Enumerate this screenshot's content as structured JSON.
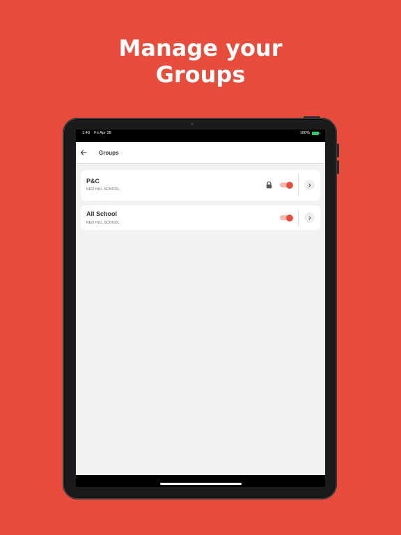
{
  "headline": {
    "line1": "Manage your",
    "line2": "Groups"
  },
  "statusbar": {
    "time": "1:48",
    "date": "Fri Apr 28",
    "battery": "100%"
  },
  "navbar": {
    "back_icon": "arrow-left-icon",
    "title": "Groups"
  },
  "groups": [
    {
      "name": "P&C",
      "school": "RED HILL SCHOOL",
      "locked": true,
      "enabled": true
    },
    {
      "name": "All School",
      "school": "RED HILL SCHOOL",
      "locked": false,
      "enabled": true
    }
  ],
  "colors": {
    "background": "#E74C3C",
    "accent": "#E74C3C",
    "toggle_track": "#F5B7B1",
    "app_background": "#F2F2F2"
  }
}
